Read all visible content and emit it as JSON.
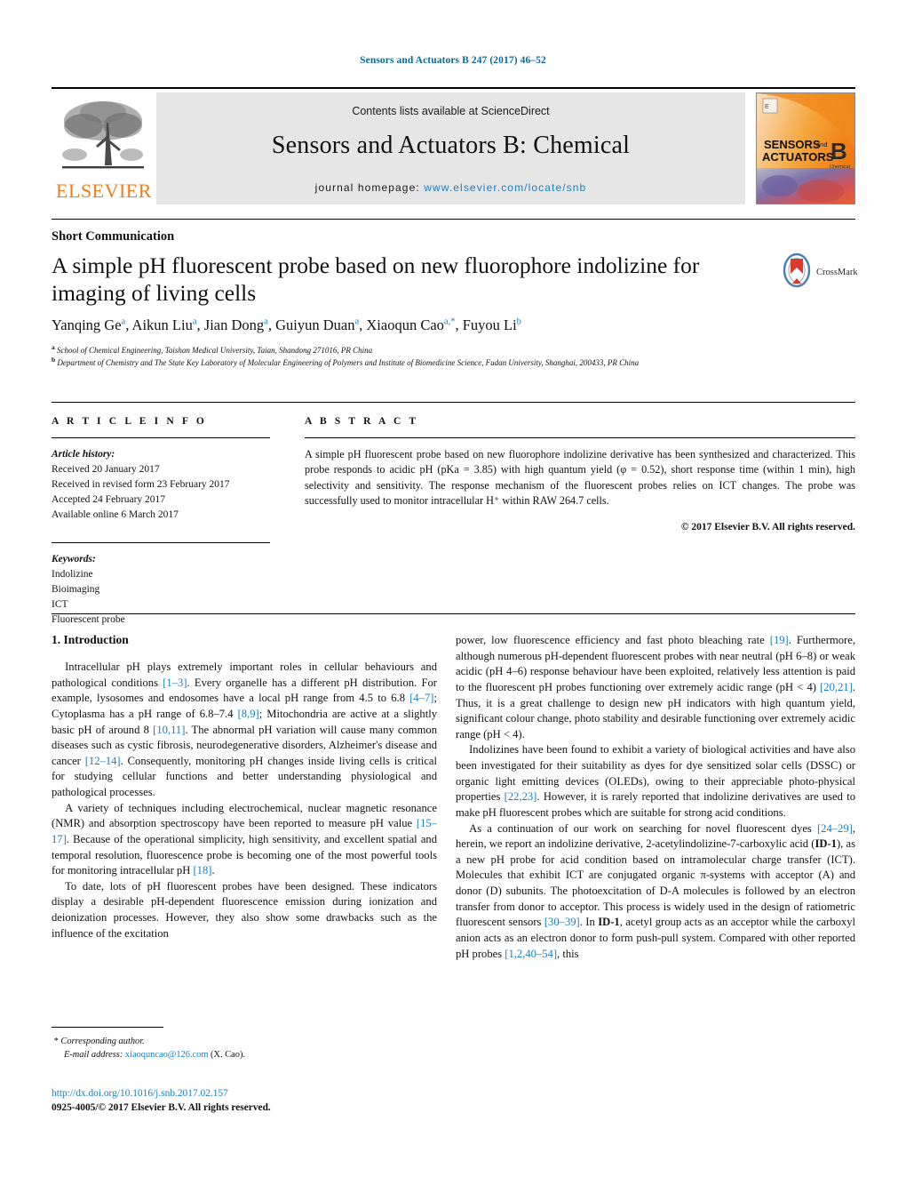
{
  "running_head": "Sensors and Actuators B 247 (2017) 46–52",
  "masthead": {
    "contents_prefix": "Contents lists available at ",
    "sciencedirect": "ScienceDirect",
    "journal_title": "Sensors and Actuators B: Chemical",
    "homepage_prefix": "journal homepage:",
    "homepage_url": "www.elsevier.com/locate/snb",
    "publisher_name": "ELSEVIER",
    "publisher_logo_icon": "elsevier-tree-icon",
    "cover_title_line1": "SENSORS",
    "cover_title_and": "and",
    "cover_title_line2": "ACTUATORS",
    "cover_letter": "B",
    "cover_sub": "Chemical"
  },
  "article": {
    "type_label": "Short Communication",
    "title": "A simple pH fluorescent probe based on new fluorophore indolizine for imaging of living cells",
    "crossmark_label": "CrossMark",
    "crossmark_icon": "crossmark-badge-icon",
    "authors_html": "Yanqing Ge<sup>a</sup>, Aikun Liu<sup>a</sup>, Jian Dong<sup>a</sup>, Guiyun Duan<sup>a</sup>, Xiaoqun Cao<sup>a,*</sup>, Fuyou Li<sup>b</sup>",
    "affiliation_a": "School of Chemical Engineering, Taishan Medical University, Taian, Shandong 271016, PR China",
    "affiliation_b": "Department of Chemistry and The State Key Laboratory of Molecular Engineering of Polymers and Institute of Biomedicine Science, Fudan University, Shanghai, 200433, PR China"
  },
  "article_info": {
    "heading": "A R T I C L E   I N F O",
    "history_label": "Article history:",
    "history": [
      "Received 20 January 2017",
      "Received in revised form 23 February 2017",
      "Accepted 24 February 2017",
      "Available online 6 March 2017"
    ],
    "keywords_label": "Keywords:",
    "keywords": [
      "Indolizine",
      "Bioimaging",
      "ICT",
      "Fluorescent probe"
    ]
  },
  "abstract": {
    "heading": "A B S T R A C T",
    "text": "A simple pH fluorescent probe based on new fluorophore indolizine derivative has been synthesized and characterized. This probe responds to acidic pH (pKa = 3.85) with high quantum yield (φ = 0.52), short response time (within 1 min), high selectivity and sensitivity. The response mechanism of the fluorescent probes relies on ICT changes. The probe was successfully used to monitor intracellular H⁺ within RAW 264.7 cells.",
    "copyright": "© 2017 Elsevier B.V. All rights reserved."
  },
  "body": {
    "section_number_title": "1.  Introduction",
    "left_paragraphs": [
      "Intracellular pH plays extremely important roles in cellular behaviours and pathological conditions <span class=\"ref\">[1–3]</span>. Every organelle has a different pH distribution. For example, lysosomes and endosomes have a local pH range from 4.5 to 6.8 <span class=\"ref\">[4–7]</span>; Cytoplasma has a pH range of 6.8–7.4 <span class=\"ref\">[8,9]</span>; Mitochondria are active at a slightly basic pH of around 8 <span class=\"ref\">[10,11]</span>. The abnormal pH variation will cause many common diseases such as cystic fibrosis, neurodegenerative disorders, Alzheimer's disease and cancer <span class=\"ref\">[12–14]</span>. Consequently, monitoring pH changes inside living cells is critical for studying cellular functions and better understanding physiological and pathological processes.",
      "A variety of techniques including electrochemical, nuclear magnetic resonance (NMR) and absorption spectroscopy have been reported to measure pH value <span class=\"ref\">[15–17]</span>. Because of the operational simplicity, high sensitivity, and excellent spatial and temporal resolution, fluorescence probe is becoming one of the most powerful tools for monitoring intracellular pH <span class=\"ref\">[18]</span>.",
      "To date, lots of pH fluorescent probes have been designed. These indicators display a desirable pH-dependent fluorescence emission during ionization and deionization processes. However, they also show some drawbacks such as the influence of the excitation"
    ],
    "right_paragraphs": [
      "power, low fluorescence efficiency and fast photo bleaching rate <span class=\"ref\">[19]</span>. Furthermore, although numerous pH-dependent fluorescent probes with near neutral (pH 6–8) or weak acidic (pH 4–6) response behaviour have been exploited, relatively less attention is paid to the fluorescent pH probes functioning over extremely acidic range (pH &lt; 4) <span class=\"ref\">[20,21]</span>. Thus, it is a great challenge to design new pH indicators with high quantum yield, significant colour change, photo stability and desirable functioning over extremely acidic range (pH &lt; 4).",
      "Indolizines have been found to exhibit a variety of biological activities and have also been investigated for their suitability as dyes for dye sensitized solar cells (DSSC) or organic light emitting devices (OLEDs), owing to their appreciable photo-physical properties <span class=\"ref\">[22,23]</span>. However, it is rarely reported that indolizine derivatives are used to make pH fluorescent probes which are suitable for strong acid conditions.",
      "As a continuation of our work on searching for novel fluorescent dyes <span class=\"ref\">[24–29]</span>, herein, we report an indolizine derivative, 2-acetylindolizine-7-carboxylic acid (<span class=\"bold\">ID-1</span>), as a new pH probe for acid condition based on intramolecular charge transfer (ICT). Molecules that exhibit ICT are conjugated organic π-systems with acceptor (A) and donor (D) subunits. The photoexcitation of D-A molecules is followed by an electron transfer from donor to acceptor. This process is widely used in the design of ratiometric fluorescent sensors <span class=\"ref\">[30–39]</span>. In <span class=\"bold\">ID-1</span>, acetyl group acts as an acceptor while the carboxyl anion acts as an electron donor to form push-pull system. Compared with other reported pH probes <span class=\"ref\">[1,2,40–54]</span>, this"
    ]
  },
  "footer": {
    "corresponding_marker": "*",
    "corresponding_label": "Corresponding author.",
    "email_label": "E-mail address:",
    "email": "xiaoquncao@126.com",
    "email_suffix": "(X. Cao).",
    "doi_url": "http://dx.doi.org/10.1016/j.snb.2017.02.157",
    "issn_line": "0925-4005/© 2017 Elsevier B.V. All rights reserved."
  },
  "colors": {
    "link": "#1a7fc1",
    "running_head": "#0b6a94",
    "elsevier_orange": "#ef7d1a",
    "band_gray": "#e6e6e6"
  }
}
